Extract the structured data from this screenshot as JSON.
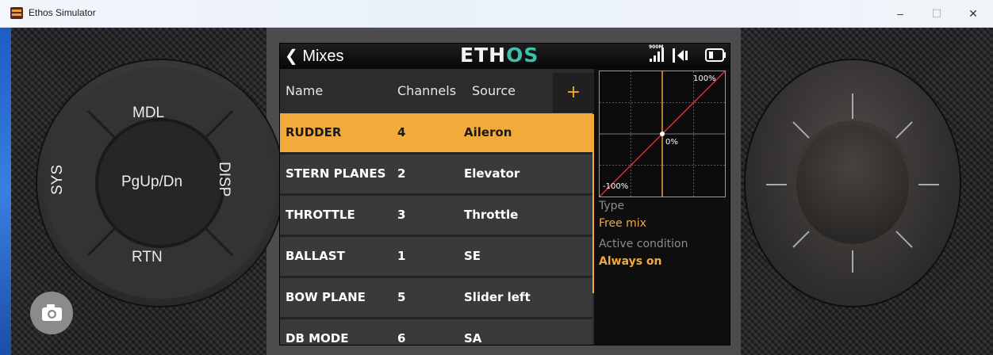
{
  "window": {
    "title": "Ethos Simulator",
    "minimize": "–",
    "maximize": "☐",
    "close": "✕",
    "icon": "ethos-app-icon"
  },
  "dial_left": {
    "top": "MDL",
    "left": "SYS",
    "center": "PgUp/Dn",
    "right": "DISP",
    "bottom": "RTN"
  },
  "camera": {
    "icon": "camera-icon"
  },
  "screen": {
    "back_label": "❮ Mixes",
    "logo_prefix": "ETH",
    "logo_suffix": "OS",
    "signal_label": "900M",
    "columns": {
      "name": "Name",
      "channels": "Channels",
      "source": "Source"
    },
    "add_label": "+",
    "rows": [
      {
        "name": "RUDDER",
        "channels": "4",
        "source": "Aileron",
        "selected": true
      },
      {
        "name": "STERN PLANES",
        "channels": "2",
        "source": "Elevator"
      },
      {
        "name": "THROTTLE",
        "channels": "3",
        "source": "Throttle"
      },
      {
        "name": "BALLAST",
        "channels": "1",
        "source": "SE"
      },
      {
        "name": "BOW PLANE",
        "channels": "5",
        "source": "Slider left"
      },
      {
        "name": "DB MODE",
        "channels": "6",
        "source": "SA"
      }
    ],
    "curve": {
      "max_label": "100%",
      "mid_label": "0%",
      "min_label": "-100%"
    },
    "details": {
      "type_label": "Type",
      "type_value": "Free mix",
      "condition_label": "Active condition",
      "condition_value": "Always on"
    }
  },
  "colors": {
    "accent": "#f2ab3b",
    "logo_accent": "#3fc0a8",
    "curve": "#e03030"
  }
}
